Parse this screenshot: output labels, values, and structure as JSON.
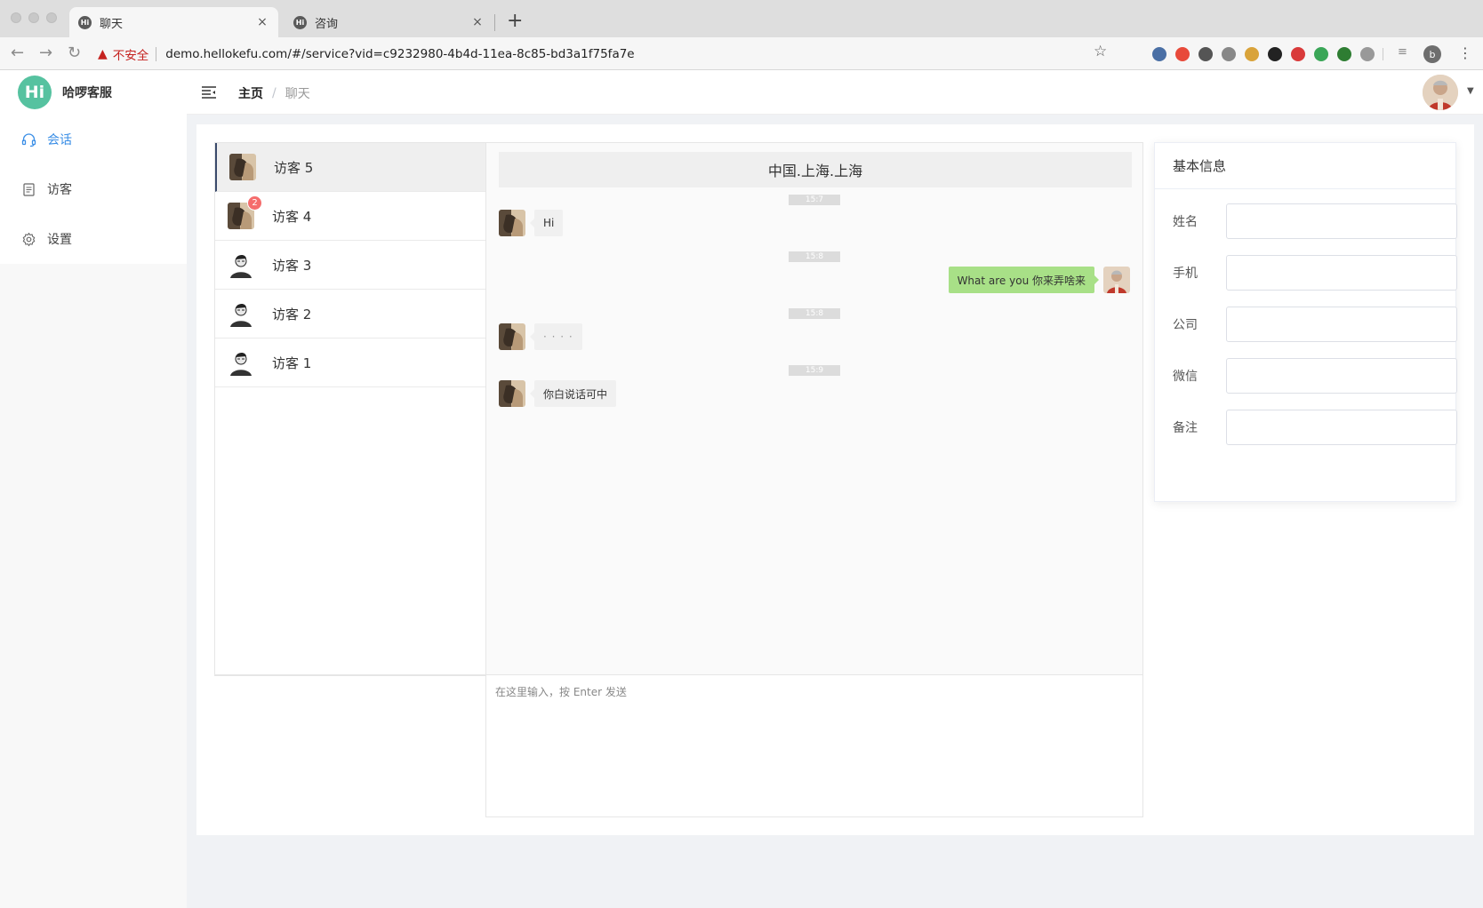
{
  "browser": {
    "tabs": [
      {
        "label": "聊天",
        "favicon": "Hi"
      },
      {
        "label": "咨询",
        "favicon": "Hi"
      }
    ],
    "new_tab": "+",
    "close": "×",
    "security_label": "不安全",
    "url": "demo.hellokefu.com/#/service?vid=c9232980-4b4d-11ea-8c85-bd3a1f75fa7e",
    "profile_initial": "b",
    "extension_colors": [
      "#4a6fa5",
      "#e84a3a",
      "#555555",
      "#888888",
      "#d9a33a",
      "#222222",
      "#d93a3a",
      "#3aa657",
      "#2e7d32",
      "#999999"
    ]
  },
  "app": {
    "logo_badge": "Hi",
    "logo_text": "哈啰客服",
    "accent_color": "#3a8ee6",
    "brand_color": "#56c2a0",
    "menu": [
      {
        "label": "会话",
        "icon": "headset-icon",
        "active": true
      },
      {
        "label": "访客",
        "icon": "document-icon",
        "active": false
      },
      {
        "label": "设置",
        "icon": "gear-icon",
        "active": false
      }
    ],
    "breadcrumb": {
      "home": "主页",
      "separator": "/",
      "current": "聊天"
    }
  },
  "visitors": [
    {
      "name": "访客 5",
      "avatar": "photo-avatar",
      "active": true,
      "unread": null
    },
    {
      "name": "访客 4",
      "avatar": "photo-avatar",
      "active": false,
      "unread": "2"
    },
    {
      "name": "访客 3",
      "avatar": "sketch-avatar",
      "active": false,
      "unread": null
    },
    {
      "name": "访客 2",
      "avatar": "sketch-avatar",
      "active": false,
      "unread": null
    },
    {
      "name": "访客 1",
      "avatar": "sketch-avatar",
      "active": false,
      "unread": null
    }
  ],
  "chat": {
    "location": "中国.上海.上海",
    "timestamps": [
      "15:7",
      "15:8",
      "15:8",
      "15:9"
    ],
    "messages": [
      {
        "side": "left",
        "text": "Hi"
      },
      {
        "side": "right",
        "text": "What are you 你来弄啥来"
      },
      {
        "side": "left",
        "text": "· · · ·"
      },
      {
        "side": "left",
        "text": "你白说话可中"
      }
    ],
    "input_placeholder": "在这里输入，按 Enter 发送"
  },
  "info_panel": {
    "title": "基本信息",
    "fields": [
      {
        "label": "姓名",
        "value": ""
      },
      {
        "label": "手机",
        "value": ""
      },
      {
        "label": "公司",
        "value": ""
      },
      {
        "label": "微信",
        "value": ""
      },
      {
        "label": "备注",
        "value": ""
      }
    ]
  }
}
